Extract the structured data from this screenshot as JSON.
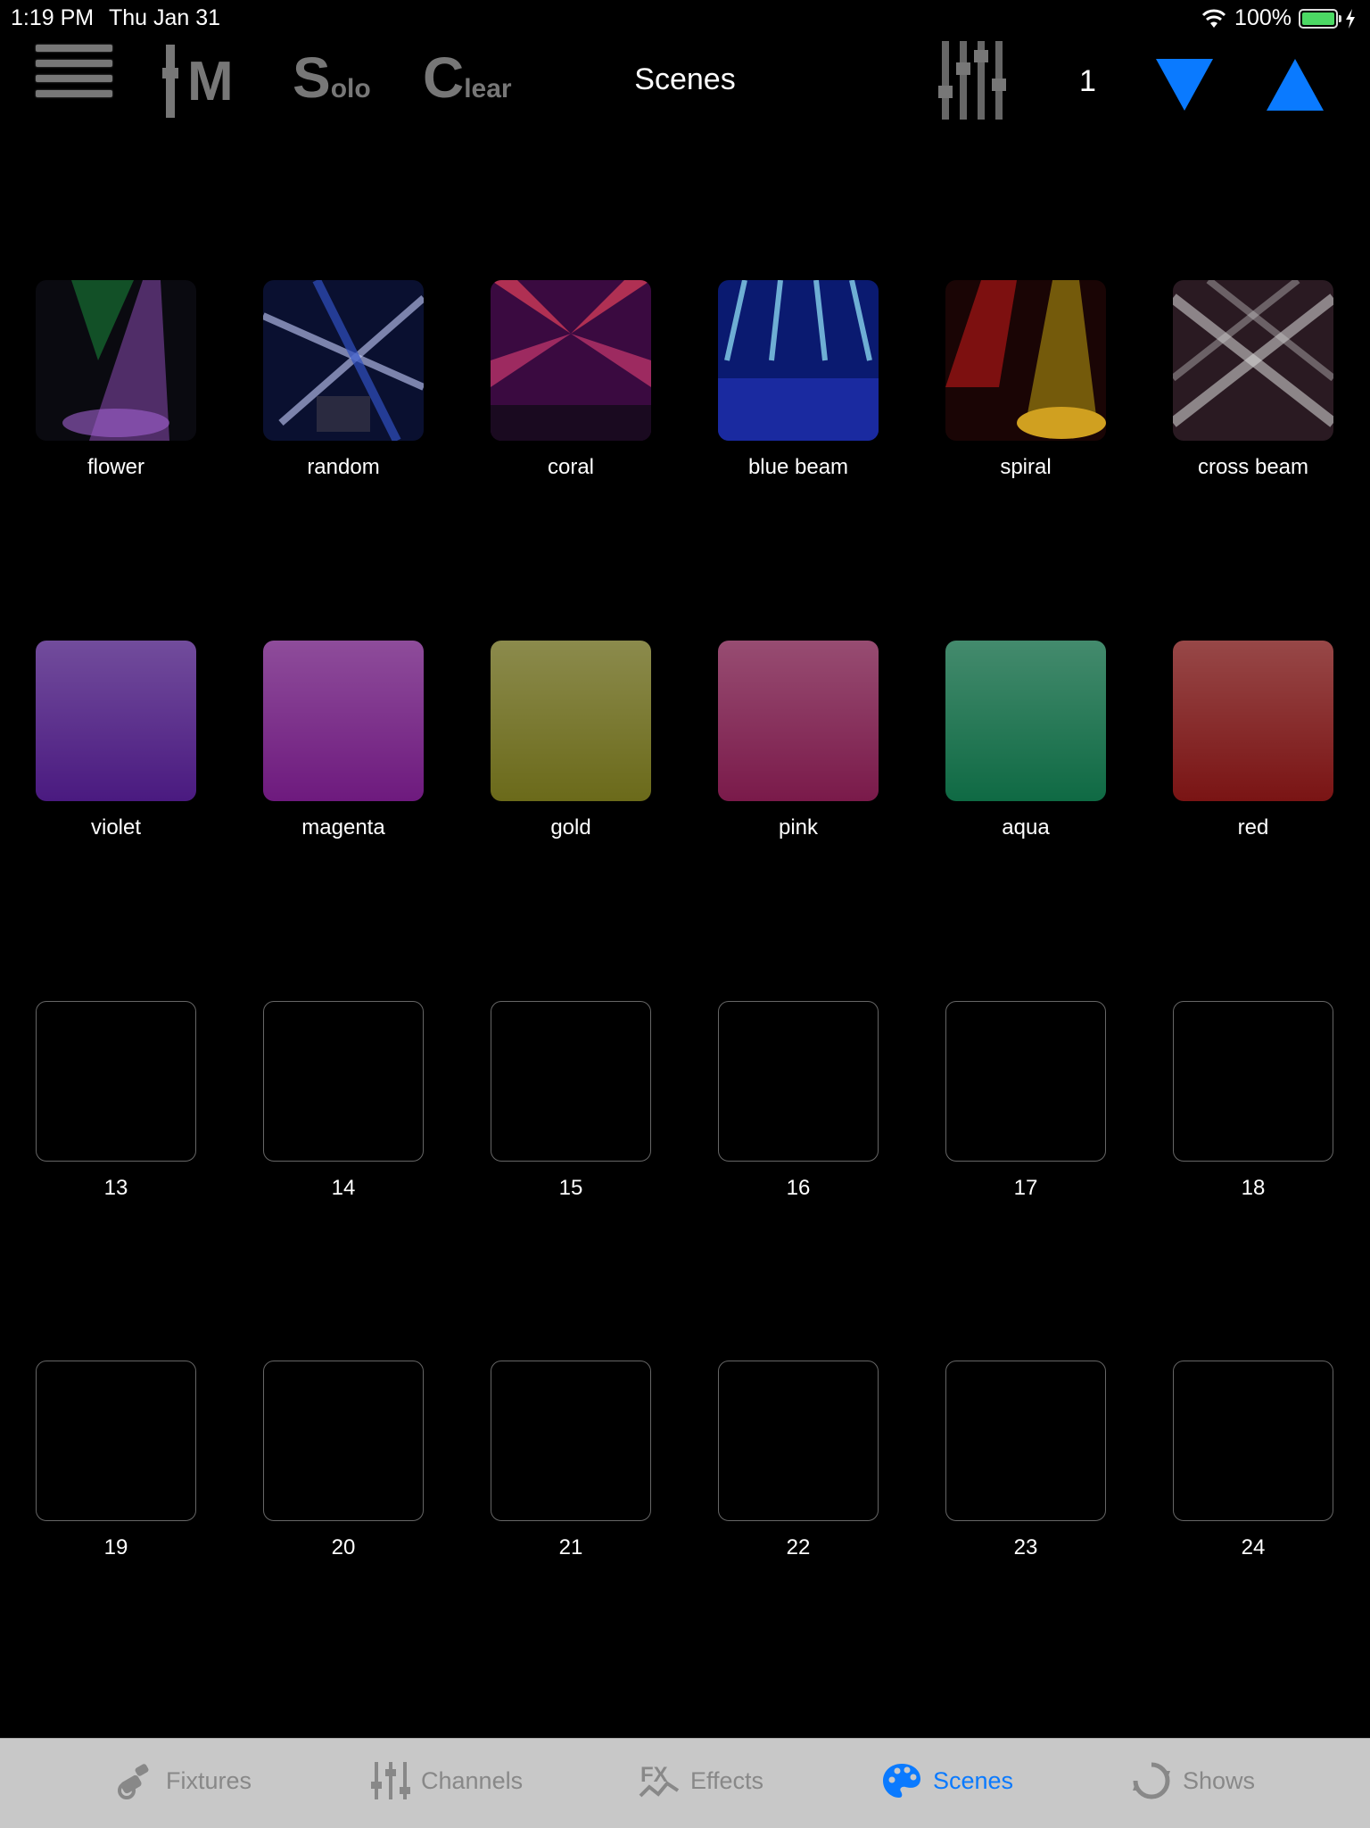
{
  "status_bar": {
    "time": "1:19 PM",
    "date": "Thu Jan 31",
    "battery": "100%",
    "battery_level": 1.0,
    "wifi_icon": "wifi-icon",
    "charging_icon": "bolt-icon"
  },
  "toolbar": {
    "mute_label": "M",
    "solo_big": "S",
    "solo_small": "olo",
    "clear_big": "C",
    "clear_small": "lear",
    "title": "Scenes",
    "page": "1",
    "accent": "#0a7aff"
  },
  "scenes": [
    {
      "label": "flower"
    },
    {
      "label": "random"
    },
    {
      "label": "coral"
    },
    {
      "label": "blue beam"
    },
    {
      "label": "spiral"
    },
    {
      "label": "cross beam"
    },
    {
      "label": "violet",
      "color": "#4a1a80"
    },
    {
      "label": "magenta",
      "color": "#6e1a7e"
    },
    {
      "label": "gold",
      "color": "#6b6a1a"
    },
    {
      "label": "pink",
      "color": "#7a1a4a"
    },
    {
      "label": "aqua",
      "color": "#0f6a44"
    },
    {
      "label": "red",
      "color": "#7a1414"
    },
    {
      "label": "13"
    },
    {
      "label": "14"
    },
    {
      "label": "15"
    },
    {
      "label": "16"
    },
    {
      "label": "17"
    },
    {
      "label": "18"
    },
    {
      "label": "19"
    },
    {
      "label": "20"
    },
    {
      "label": "21"
    },
    {
      "label": "22"
    },
    {
      "label": "23"
    },
    {
      "label": "24"
    }
  ],
  "tabs": [
    {
      "label": "Fixtures",
      "icon": "fixture-icon"
    },
    {
      "label": "Channels",
      "icon": "sliders-icon"
    },
    {
      "label": "Effects",
      "icon": "fx-icon"
    },
    {
      "label": "Scenes",
      "icon": "palette-icon",
      "active": true
    },
    {
      "label": "Shows",
      "icon": "cycle-icon"
    }
  ]
}
